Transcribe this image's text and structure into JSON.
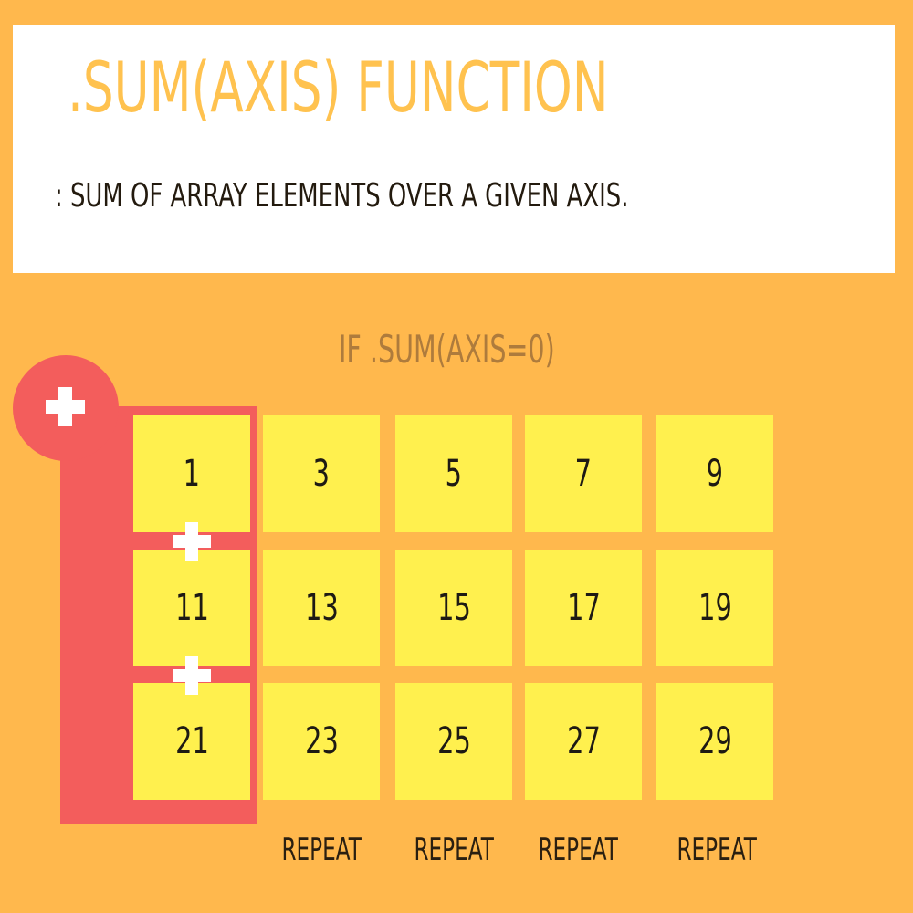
{
  "header": {
    "title": ".SUM(AXIS) FUNCTION",
    "description": ": SUM OF ARRAY ELEMENTS OVER A GIVEN AXIS."
  },
  "diagram": {
    "axis_label": "IF .SUM(AXIS=0)",
    "matrix": [
      [
        "1",
        "3",
        "5",
        "7",
        "9"
      ],
      [
        "11",
        "13",
        "15",
        "17",
        "19"
      ],
      [
        "21",
        "23",
        "25",
        "27",
        "29"
      ]
    ],
    "repeat_labels": [
      "REPEAT",
      "REPEAT",
      "REPEAT",
      "REPEAT"
    ],
    "icons": {
      "plus_large": "plus-icon",
      "plus_small": "plus-icon"
    }
  },
  "colors": {
    "background": "#FFB84D",
    "panel": "#FFFFFF",
    "title": "#FFC24F",
    "text": "#231A0E",
    "axis_label": "#AE7B3C",
    "accent": "#F35D5C",
    "cell": "#FFF04E"
  }
}
